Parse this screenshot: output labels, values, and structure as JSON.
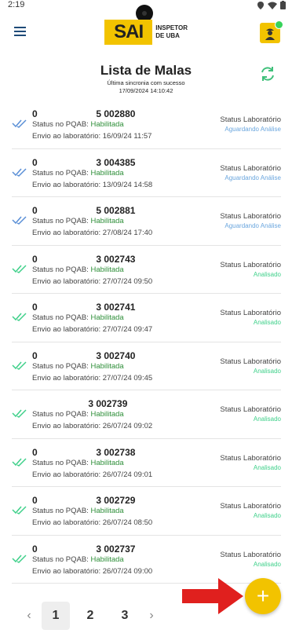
{
  "status_bar": {
    "time": "2:19"
  },
  "header": {
    "logo_mark": "SAI",
    "logo_line1": "INSPETOR",
    "logo_line2": "DE UBA",
    "menu_icon": "hamburger-menu-icon",
    "sync_icon": "refresh-icon"
  },
  "page": {
    "title": "Lista de Malas",
    "sync_label": "Última sincronia com sucesso",
    "sync_time": "17/09/2024 14:10:42"
  },
  "colors": {
    "accent": "#f2c300",
    "aguardando": "#6aa6de",
    "analisado": "#3fd08a",
    "habilitada": "#2f8f3a",
    "check_blue": "#5a8fd6",
    "check_green": "#3fd08a"
  },
  "items": [
    {
      "code_prefix": "0",
      "code_suffix": "5 002880",
      "pqab_label": "Status no PQAB:",
      "pqab_value": "Habilitada",
      "envio": "Envio ao laboratório: 16/09/24 11:57",
      "lab_label": "Status Laboratório",
      "lab_status": "Aguardando Análise",
      "state": "aguardando"
    },
    {
      "code_prefix": "0",
      "code_suffix": "3 004385",
      "pqab_label": "Status no PQAB:",
      "pqab_value": "Habilitada",
      "envio": "Envio ao laboratório: 13/09/24 14:58",
      "lab_label": "Status Laboratório",
      "lab_status": "Aguardando Análise",
      "state": "aguardando"
    },
    {
      "code_prefix": "0",
      "code_suffix": "5 002881",
      "pqab_label": "Status no PQAB:",
      "pqab_value": "Habilitada",
      "envio": "Envio ao laboratório: 27/08/24 17:40",
      "lab_label": "Status Laboratório",
      "lab_status": "Aguardando Análise",
      "state": "aguardando"
    },
    {
      "code_prefix": "0",
      "code_suffix": "3 002743",
      "pqab_label": "Status no PQAB:",
      "pqab_value": "Habilitada",
      "envio": "Envio ao laboratório: 27/07/24 09:50",
      "lab_label": "Status Laboratório",
      "lab_status": "Analisado",
      "state": "analisado"
    },
    {
      "code_prefix": "0",
      "code_suffix": "3 002741",
      "pqab_label": "Status no PQAB:",
      "pqab_value": "Habilitada",
      "envio": "Envio ao laboratório: 27/07/24 09:47",
      "lab_label": "Status Laboratório",
      "lab_status": "Analisado",
      "state": "analisado"
    },
    {
      "code_prefix": "0",
      "code_suffix": "3 002740",
      "pqab_label": "Status no PQAB:",
      "pqab_value": "Habilitada",
      "envio": "Envio ao laboratório: 27/07/24 09:45",
      "lab_label": "Status Laboratório",
      "lab_status": "Analisado",
      "state": "analisado"
    },
    {
      "code_prefix": "",
      "code_suffix": "3 002739",
      "pqab_label": "Status no PQAB:",
      "pqab_value": "Habilitada",
      "envio": "Envio ao laboratório: 26/07/24 09:02",
      "lab_label": "Status Laboratório",
      "lab_status": "Analisado",
      "state": "analisado"
    },
    {
      "code_prefix": "0",
      "code_suffix": "3 002738",
      "pqab_label": "Status no PQAB:",
      "pqab_value": "Habilitada",
      "envio": "Envio ao laboratório: 26/07/24 09:01",
      "lab_label": "Status Laboratório",
      "lab_status": "Analisado",
      "state": "analisado"
    },
    {
      "code_prefix": "0",
      "code_suffix": "3 002729",
      "pqab_label": "Status no PQAB:",
      "pqab_value": "Habilitada",
      "envio": "Envio ao laboratório: 26/07/24 08:50",
      "lab_label": "Status Laboratório",
      "lab_status": "Analisado",
      "state": "analisado"
    },
    {
      "code_prefix": "0",
      "code_suffix": "3 002737",
      "pqab_label": "Status no PQAB:",
      "pqab_value": "Habilitada",
      "envio": "Envio ao laboratório: 26/07/24 09:00",
      "lab_label": "Status Laboratório",
      "lab_status": "Analisado",
      "state": "analisado"
    }
  ],
  "pagination": {
    "prev_icon": "chevron-left-icon",
    "next_icon": "chevron-right-icon",
    "pages": [
      "1",
      "2",
      "3"
    ],
    "active": "1"
  },
  "fab": {
    "label": "+",
    "icon": "plus-icon"
  },
  "annotation": {
    "icon": "red-arrow-icon"
  }
}
